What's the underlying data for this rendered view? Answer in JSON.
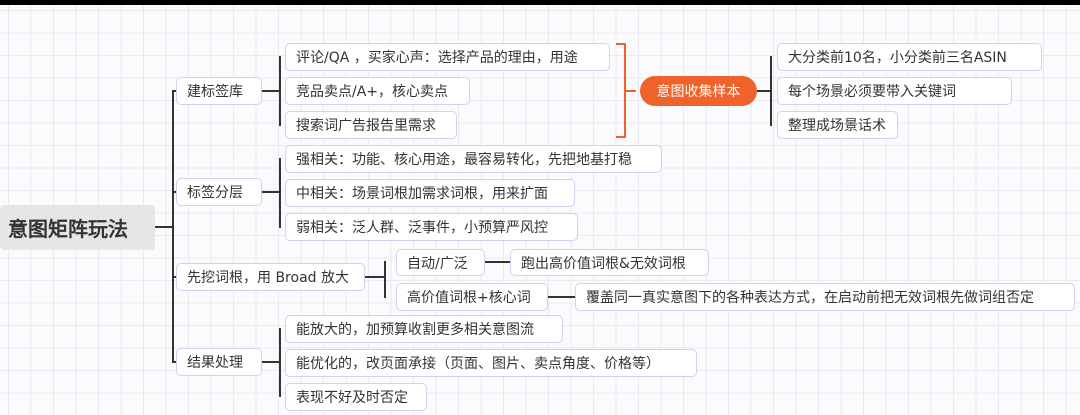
{
  "root": "意图矩阵玩法",
  "branches": [
    {
      "label": "建标签库",
      "children": [
        "评论/QA ，买家心声：选择产品的理由，用途",
        "竞品卖点/A+，核心卖点",
        "搜索词广告报告里需求"
      ]
    },
    {
      "label": "标签分层",
      "children": [
        "强相关：功能、核心用途，最容易转化，先把地基打稳",
        "中相关：场景词根加需求词根，用来扩面",
        "弱相关：泛人群、泛事件，小预算严风控"
      ]
    },
    {
      "label": "先挖词根，用 Broad 放大",
      "children": [
        {
          "label": "自动/广泛",
          "child": "跑出高价值词根&无效词根"
        },
        {
          "label": "高价值词根+核心词",
          "child": "覆盖同一真实意图下的各种表达方式，在启动前把无效词根先做词组否定"
        }
      ]
    },
    {
      "label": "结果处理",
      "children": [
        "能放大的，加预算收割更多相关意图流",
        "能优化的，改页面承接（页面、图片、卖点角度、价格等）",
        "表现不好及时否定"
      ]
    }
  ],
  "summary": {
    "label": "意图收集样本",
    "children": [
      "大分类前10名，小分类前三名ASIN",
      "每个场景必须要带入关键词",
      "整理成场景话术"
    ]
  },
  "colors": {
    "accent": "#f0622b",
    "node_border": "#cdd3f3",
    "root_bg": "#e6e6e6"
  }
}
